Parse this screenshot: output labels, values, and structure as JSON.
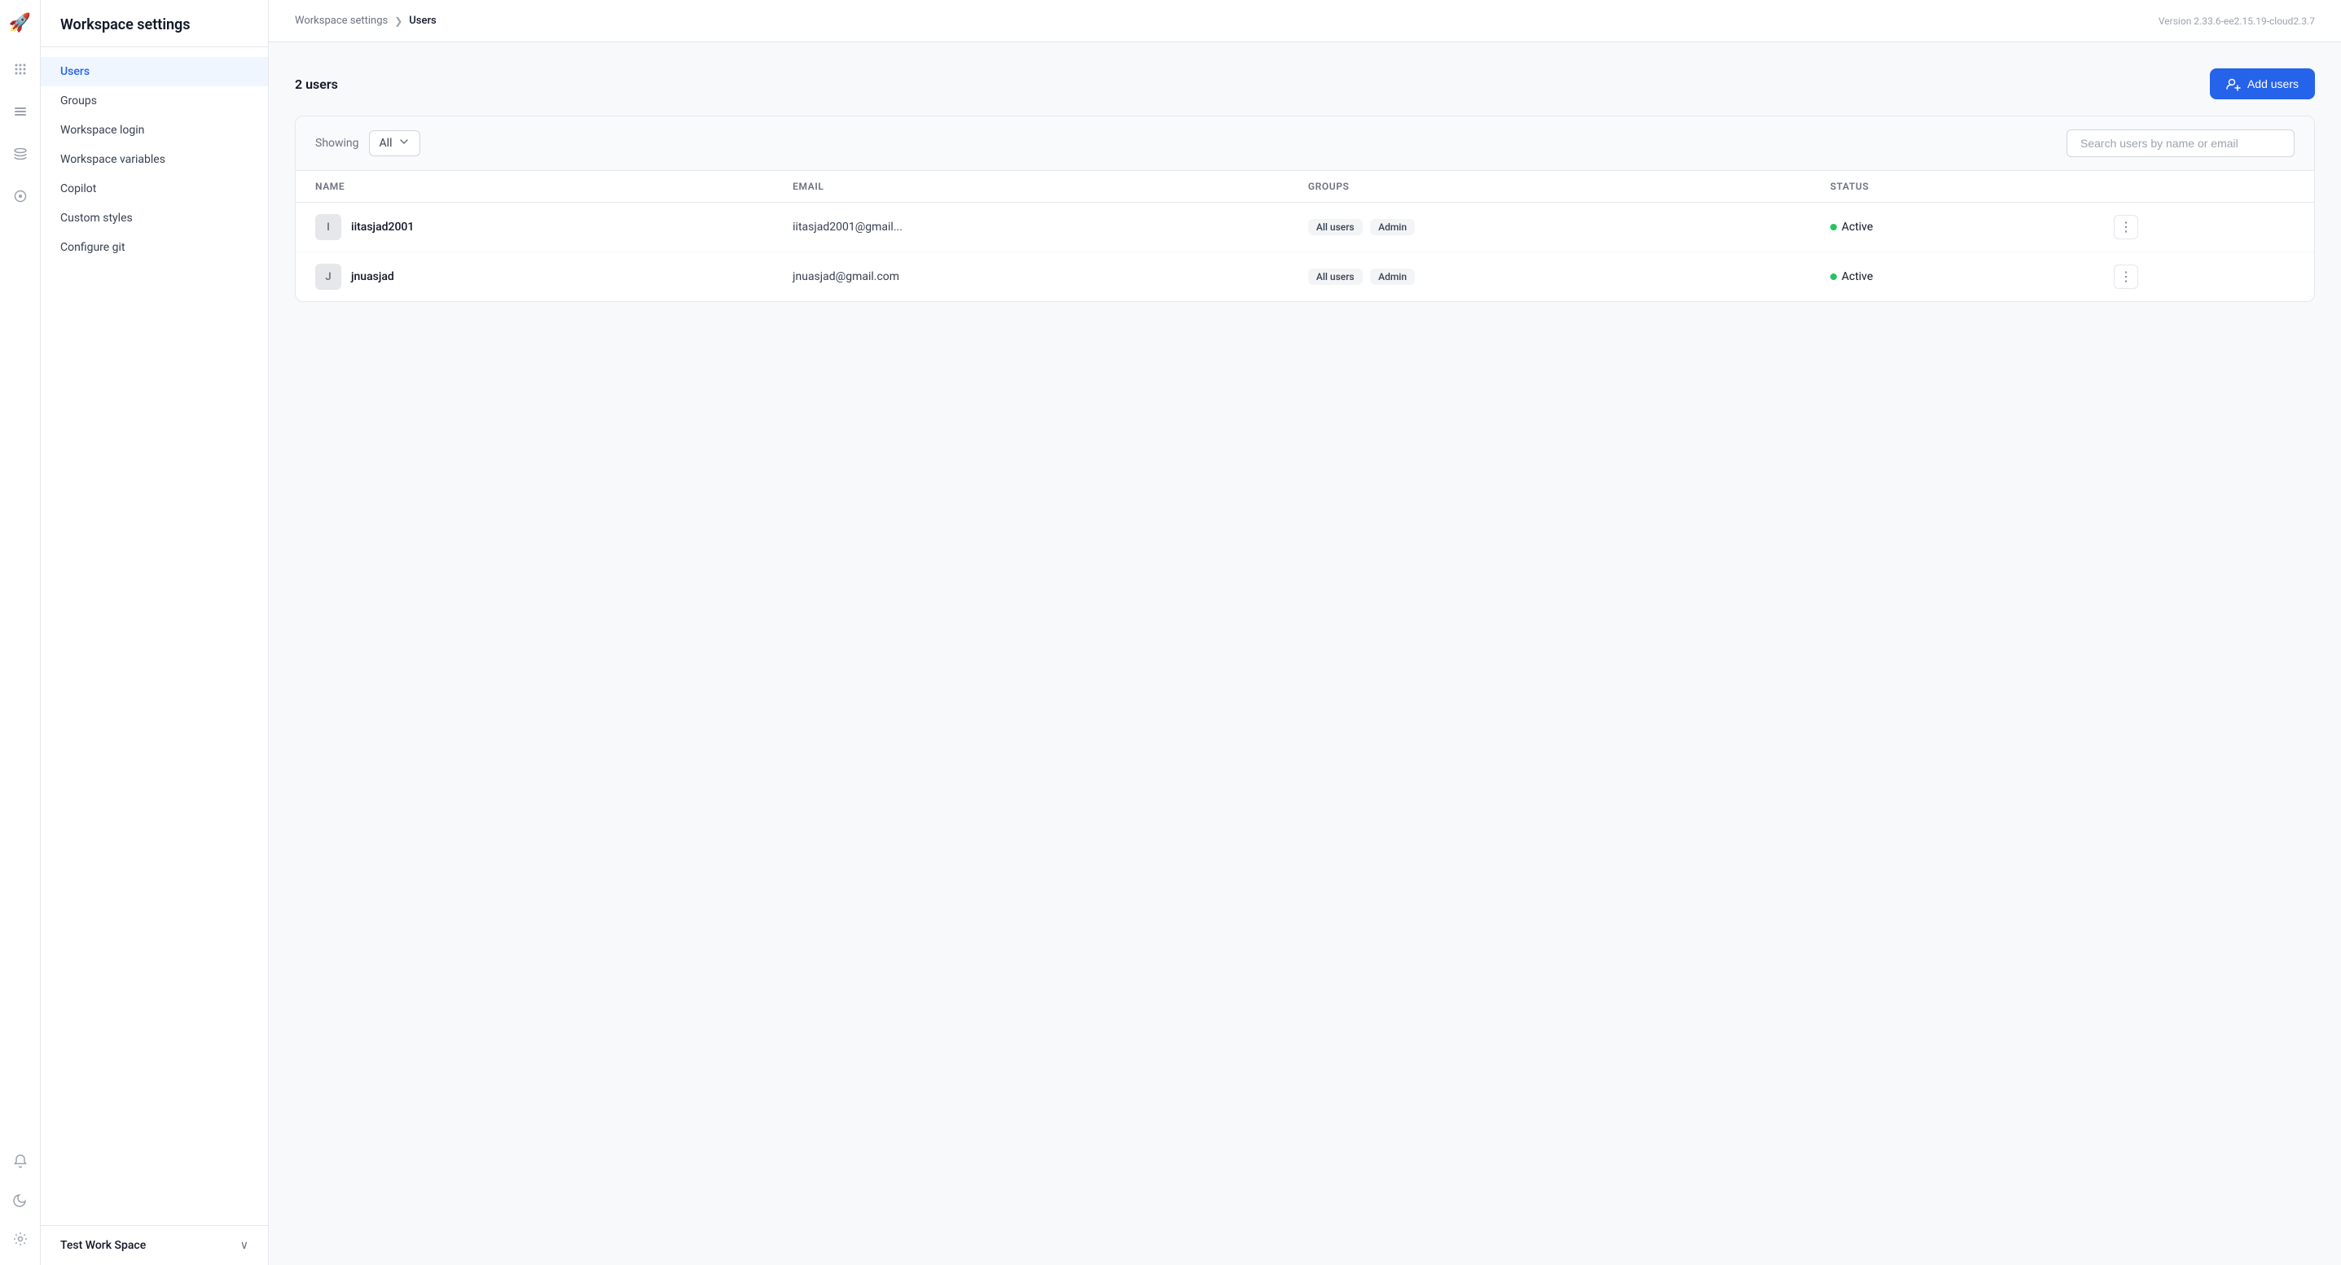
{
  "app": {
    "logo": "🚀",
    "version": "Version 2.33.6-ee2.15.19-cloud2.3.7"
  },
  "sidebar": {
    "title": "Workspace settings",
    "items": [
      {
        "id": "users",
        "label": "Users",
        "active": true
      },
      {
        "id": "groups",
        "label": "Groups",
        "active": false
      },
      {
        "id": "workspace-login",
        "label": "Workspace login",
        "active": false
      },
      {
        "id": "workspace-variables",
        "label": "Workspace variables",
        "active": false
      },
      {
        "id": "copilot",
        "label": "Copilot",
        "active": false
      },
      {
        "id": "custom-styles",
        "label": "Custom styles",
        "active": false
      },
      {
        "id": "configure-git",
        "label": "Configure git",
        "active": false
      }
    ],
    "workspace": {
      "name": "Test Work Space"
    }
  },
  "breadcrumb": {
    "parent": "Workspace settings",
    "chevron": "❯",
    "current": "Users"
  },
  "users_page": {
    "count_label": "2 users",
    "add_button_label": "Add users",
    "filter": {
      "showing_label": "Showing",
      "value": "All"
    },
    "search": {
      "placeholder": "Search users by name or email"
    },
    "table": {
      "columns": [
        "NAME",
        "EMAIL",
        "GROUPS",
        "STATUS"
      ],
      "rows": [
        {
          "avatar_letter": "I",
          "name": "iitasjad2001",
          "email": "iitasjad2001@gmail...",
          "groups": [
            "All users",
            "Admin"
          ],
          "status": "Active"
        },
        {
          "avatar_letter": "J",
          "name": "jnuasjad",
          "email": "jnuasjad@gmail.com",
          "groups": [
            "All users",
            "Admin"
          ],
          "status": "Active"
        }
      ]
    }
  },
  "icons": {
    "dots_grid": "⠿",
    "list": "☰",
    "stack": "⊟",
    "plugin": "⚙",
    "bell": "🔔",
    "moon": "🌙",
    "gear": "⚙",
    "chevron_down": "∨",
    "add_users": "👥"
  }
}
